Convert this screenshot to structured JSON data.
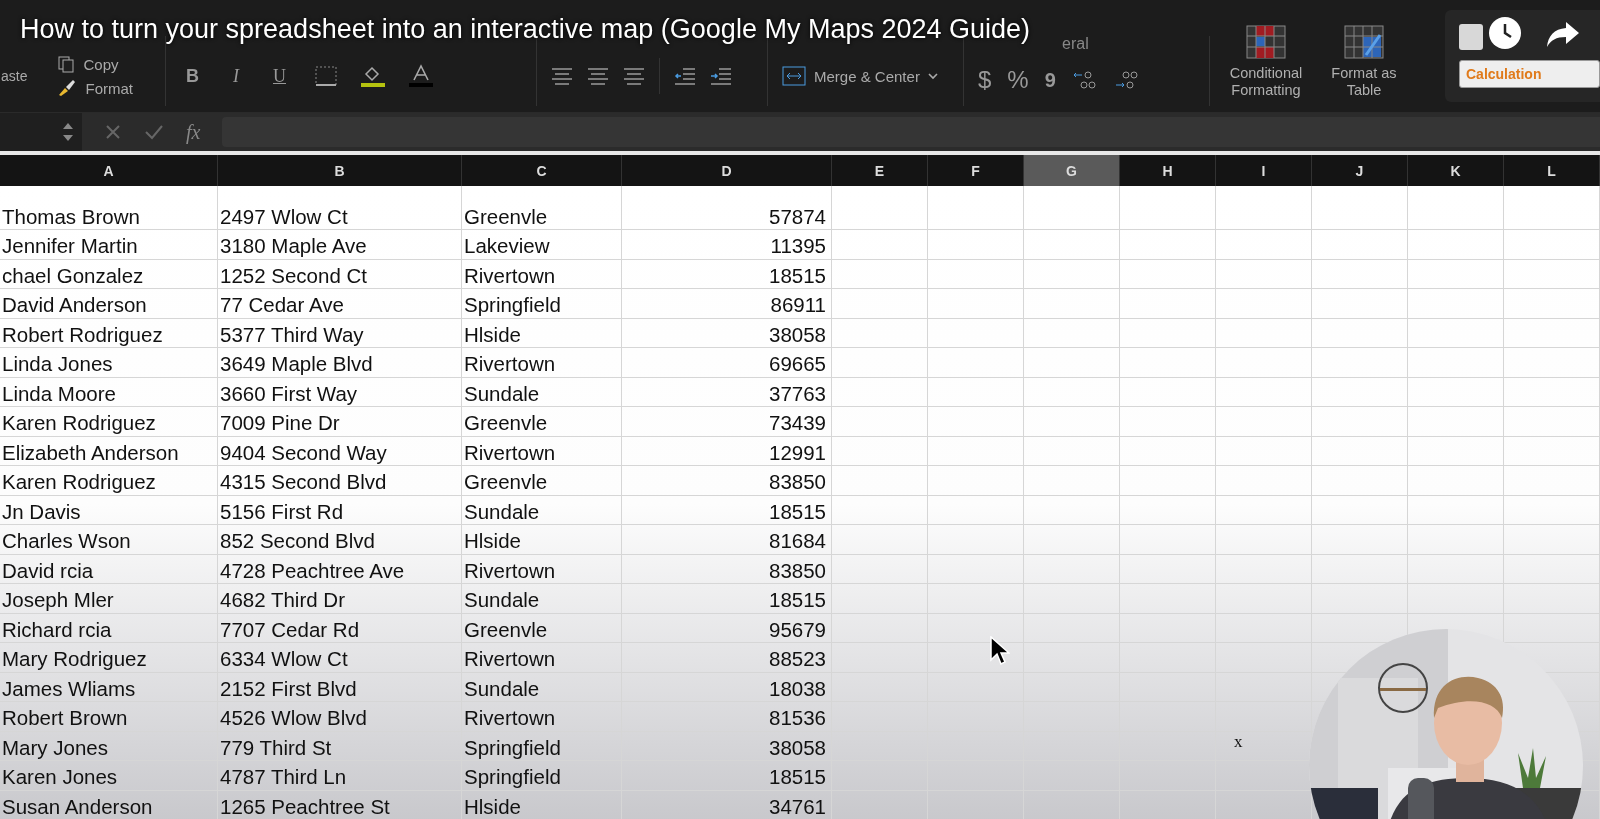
{
  "video_title": "How to turn your spreadsheet into an interactive map (Google My Maps 2024 Guide)",
  "ribbon": {
    "paste": "aste",
    "copy": "Copy",
    "format_painter": "Format",
    "bold": "B",
    "italic": "I",
    "underline": "U",
    "merge": "Merge & Center",
    "number_format": "eral",
    "currency": "$",
    "percent": "%",
    "comma": "9",
    "conditional": "Conditional Formatting",
    "format_table": "Format as Table",
    "style_calc": "Calculation"
  },
  "formula_bar": {
    "fx": "fx"
  },
  "columns": [
    {
      "label": "A",
      "selected": false
    },
    {
      "label": "B",
      "selected": false
    },
    {
      "label": "C",
      "selected": false
    },
    {
      "label": "D",
      "selected": false
    },
    {
      "label": "E",
      "selected": false
    },
    {
      "label": "F",
      "selected": false
    },
    {
      "label": "G",
      "selected": true
    },
    {
      "label": "H",
      "selected": false
    },
    {
      "label": "I",
      "selected": false
    },
    {
      "label": "J",
      "selected": false
    },
    {
      "label": "K",
      "selected": false
    },
    {
      "label": "L",
      "selected": false
    }
  ],
  "rows": [
    [
      "Thomas Brown",
      "2497 Wlow Ct",
      "Greenvle",
      "57874"
    ],
    [
      "Jennifer Martin",
      "3180 Maple Ave",
      "Lakeview",
      "11395"
    ],
    [
      "chael Gonzalez",
      "1252 Second Ct",
      "Rivertown",
      "18515"
    ],
    [
      "David Anderson",
      "77 Cedar Ave",
      "Springfield",
      "86911"
    ],
    [
      "Robert Rodriguez",
      "5377 Third Way",
      "Hlside",
      "38058"
    ],
    [
      "Linda Jones",
      "3649 Maple Blvd",
      "Rivertown",
      "69665"
    ],
    [
      "Linda Moore",
      "3660 First Way",
      "Sundale",
      "37763"
    ],
    [
      "Karen Rodriguez",
      "7009 Pine Dr",
      "Greenvle",
      "73439"
    ],
    [
      "Elizabeth Anderson",
      "9404 Second Way",
      "Rivertown",
      "12991"
    ],
    [
      "Karen Rodriguez",
      "4315 Second Blvd",
      "Greenvle",
      "83850"
    ],
    [
      "Jn Davis",
      "5156 First Rd",
      "Sundale",
      "18515"
    ],
    [
      "Charles Wson",
      "852 Second Blvd",
      "Hlside",
      "81684"
    ],
    [
      "David rcia",
      "4728 Peachtree Ave",
      "Rivertown",
      "83850"
    ],
    [
      "Joseph Mler",
      "4682 Third Dr",
      "Sundale",
      "18515"
    ],
    [
      "Richard rcia",
      "7707 Cedar Rd",
      "Greenvle",
      "95679"
    ],
    [
      "Mary Rodriguez",
      "6334 Wlow Ct",
      "Rivertown",
      "88523"
    ],
    [
      "James Wliams",
      "2152 First Blvd",
      "Sundale",
      "18038"
    ],
    [
      "Robert Brown",
      "4526 Wlow Blvd",
      "Rivertown",
      "81536"
    ],
    [
      "Mary Jones",
      "779 Third St",
      "Springfield",
      "38058"
    ],
    [
      "Karen Jones",
      "4787 Third Ln",
      "Springfield",
      "18515"
    ],
    [
      "Susan Anderson",
      "1265 Peachtree St",
      "Hlside",
      "34761"
    ]
  ],
  "stray_mark": "x"
}
